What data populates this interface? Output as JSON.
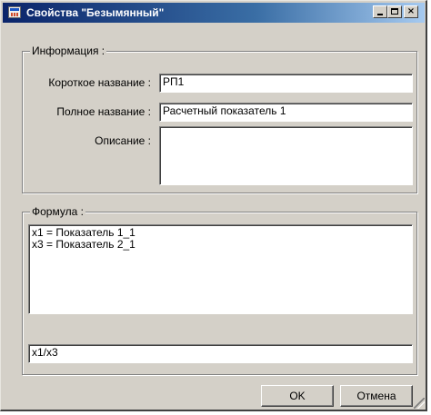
{
  "window": {
    "title": "Свойства \"Безымянный\"",
    "controls": {
      "minimize": "_",
      "maximize": "□",
      "close": "×"
    }
  },
  "info": {
    "legend": "Информация :",
    "short_name_label": "Короткое название :",
    "short_name_value": "РП1",
    "full_name_label": "Полное название :",
    "full_name_value": "Расчетный показатель 1",
    "description_label": "Описание :",
    "description_value": ""
  },
  "formula": {
    "legend": "Формула :",
    "variables_text": "x1 = Показатель 1_1\nx3 = Показатель 2_1",
    "expression_value": "x1/x3"
  },
  "buttons": {
    "ok": "OK",
    "cancel": "Отмена"
  },
  "icons": [
    "app-icon",
    "minimize-icon",
    "maximize-icon",
    "close-icon",
    "resize-grip-icon"
  ]
}
